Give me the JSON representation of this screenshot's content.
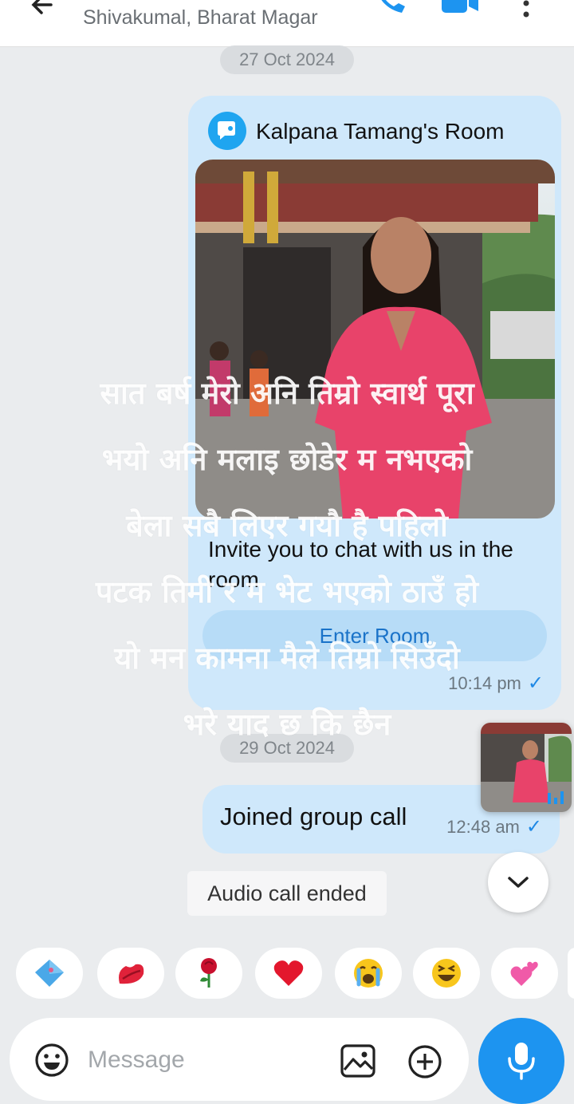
{
  "header": {
    "subtitle": "Shivakumal, Bharat Magar"
  },
  "dates": {
    "first": "27 Oct 2024",
    "second": "29 Oct 2024"
  },
  "invite_card": {
    "room_title": "Kalpana Tamang's Room",
    "invite_text": "Invite you to chat with us in the room",
    "enter_button": "Enter Room",
    "time": "10:14 pm",
    "tick": "✓"
  },
  "joined_message": {
    "text": "Joined group call",
    "time": "12:48 am",
    "tick": "✓"
  },
  "audio_call": {
    "text": "Audio call ended"
  },
  "overlay_caption": {
    "lines": [
      "सात बर्ष मेरो अनि तिम्रो स्वार्थ पूरा",
      "भयो अनि मलाइ छोडेर म नभएको",
      "बेला सबै लिएर गयौ है पहिलो",
      "पटक तिमी र म भेट भएको ठाउँ हो",
      "यो मन कामना मैले तिम्रो सिउँदो",
      "भरे याद छ कि छैन"
    ]
  },
  "quick_reactions": [
    "💎",
    "💋",
    "🌹",
    "❤️",
    "😭",
    "😆",
    "💕"
  ],
  "composer": {
    "placeholder": "Message"
  },
  "icons": {
    "back": "back-arrow-icon",
    "call": "phone-icon",
    "video": "video-camera-icon",
    "more": "more-vert-icon",
    "scroll": "chevron-down-icon",
    "emoji": "smiley-icon",
    "gallery": "image-gallery-icon",
    "attach": "plus-circle-icon",
    "mic": "microphone-icon"
  },
  "colors": {
    "accent": "#1d94f0",
    "bubble": "#cfe8fb",
    "background": "#eaecee"
  }
}
